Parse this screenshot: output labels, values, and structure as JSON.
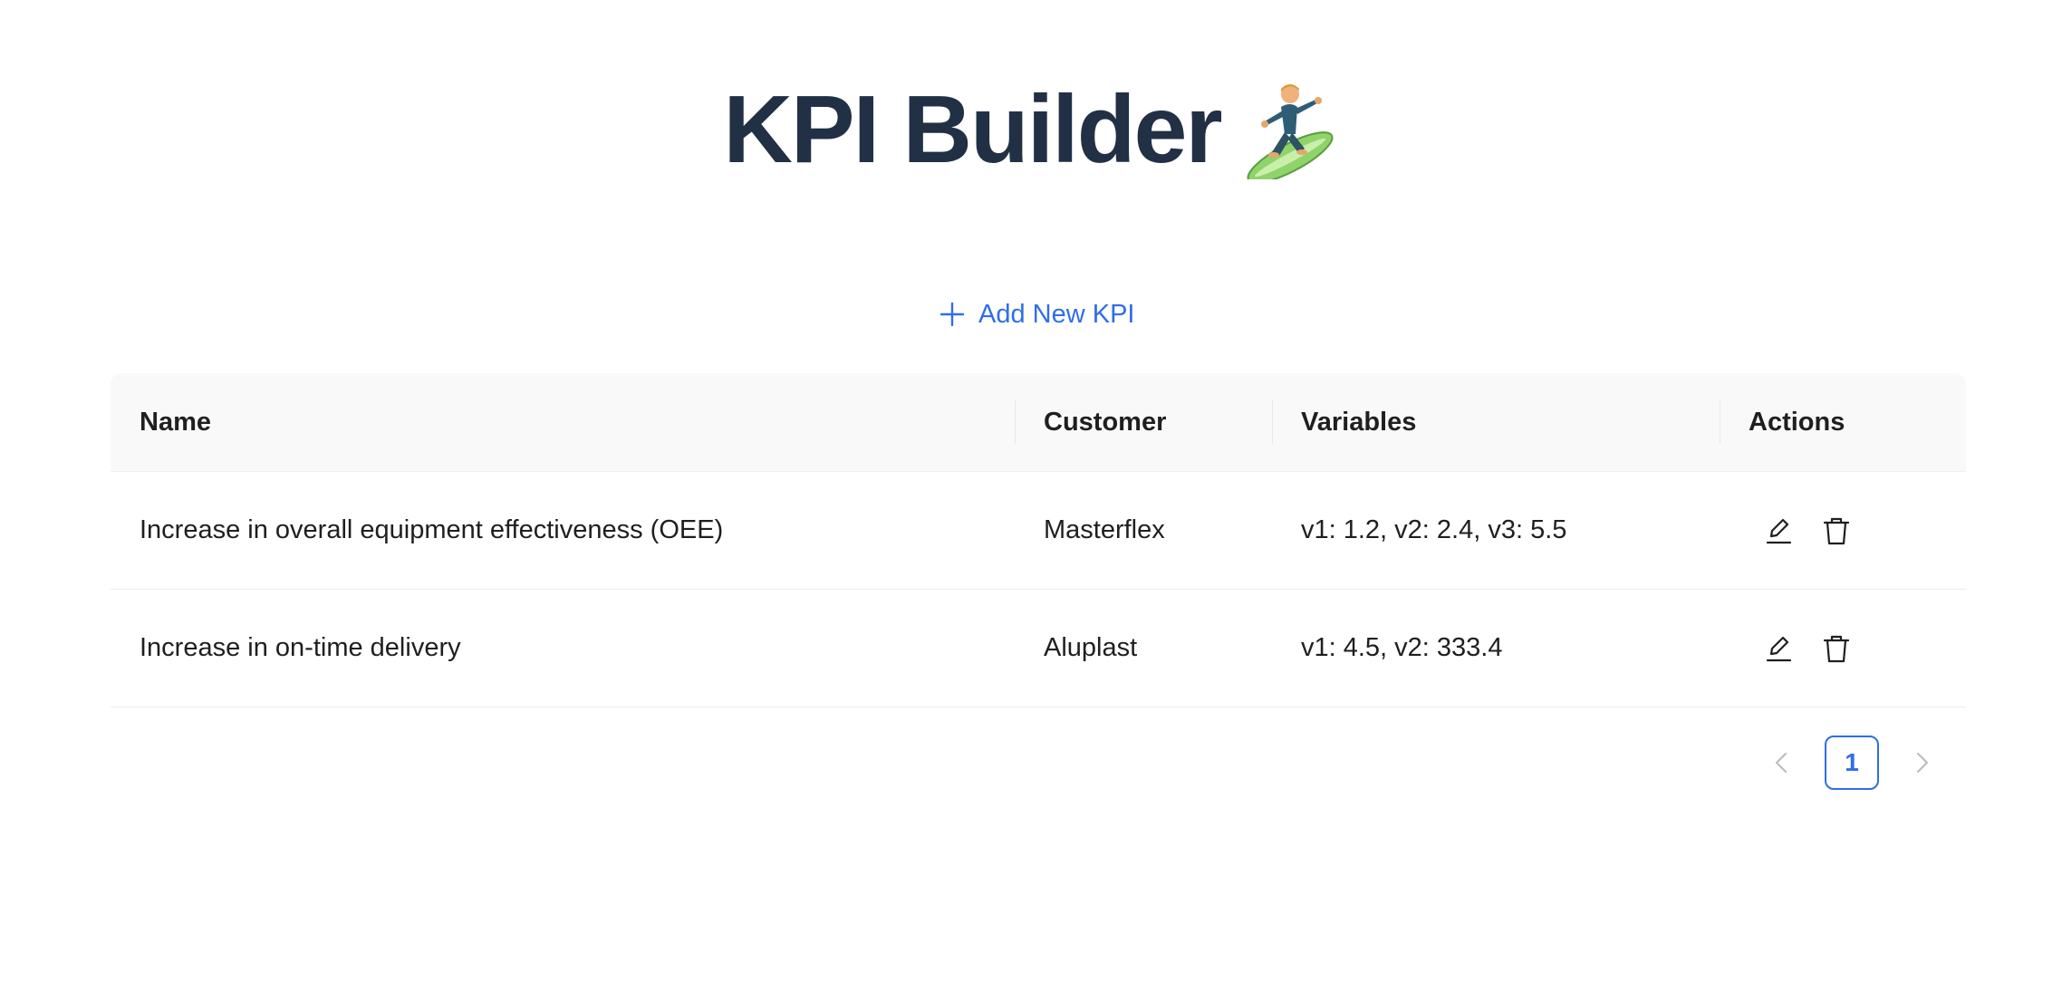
{
  "header": {
    "title": "KPI Builder",
    "emoji_icon": "surfer-icon"
  },
  "toolbar": {
    "add_label": "Add New KPI",
    "add_icon": "plus-icon"
  },
  "table": {
    "columns": [
      "Name",
      "Customer",
      "Variables",
      "Actions"
    ],
    "rows": [
      {
        "name": "Increase in overall equipment effectiveness (OEE)",
        "customer": "Masterflex",
        "variables": "v1: 1.2, v2: 2.4, v3: 5.5"
      },
      {
        "name": "Increase in on-time delivery",
        "customer": "Aluplast",
        "variables": "v1: 4.5, v2: 333.4"
      }
    ],
    "action_icons": [
      "edit-icon",
      "trash-icon"
    ]
  },
  "pagination": {
    "current_page": "1"
  },
  "colors": {
    "title": "#223045",
    "accent": "#2f6ee8",
    "header_bg": "#f9f9f9",
    "text": "#1f1f1f"
  }
}
